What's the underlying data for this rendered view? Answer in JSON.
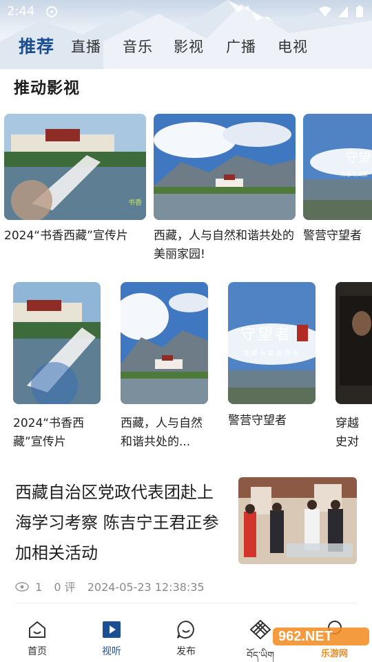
{
  "status_bar": {
    "time": "2:44"
  },
  "tabs": [
    {
      "label": "推荐",
      "active": true
    },
    {
      "label": "直播",
      "active": false
    },
    {
      "label": "音乐",
      "active": false
    },
    {
      "label": "影视",
      "active": false
    },
    {
      "label": "广播",
      "active": false
    },
    {
      "label": "电视",
      "active": false
    }
  ],
  "section": {
    "title": "推动影视"
  },
  "row1": [
    {
      "title": "2024“书香西藏”宣传片"
    },
    {
      "title": "西藏，人与自然和谐共处的美丽家园!"
    },
    {
      "title": "警营守望者"
    }
  ],
  "row2": [
    {
      "title": "2024“书香西藏”宣传片"
    },
    {
      "title": "西藏，人与自然和谐共处的..."
    },
    {
      "title": "警营守望者",
      "overlay_title": "守望者",
      "overlay_sub": "青春与高原同在"
    },
    {
      "title": "穿越史对"
    }
  ],
  "news": {
    "title": "西藏自治区党政代表团赴上海学习考察 陈吉宁王君正参加相关活动",
    "views": "1",
    "comments": "0 评",
    "date": "2024-05-23 12:38:35"
  },
  "bottom_nav": [
    {
      "label": "首页",
      "icon": "home-icon",
      "active": false
    },
    {
      "label": "视听",
      "icon": "play-icon",
      "active": true
    },
    {
      "label": "发布",
      "icon": "chat-icon",
      "active": false
    },
    {
      "label": "བོད་ཡིག",
      "icon": "knot-icon",
      "active": false
    },
    {
      "label": "",
      "icon": "profile-icon",
      "active": false
    }
  ],
  "watermark": {
    "text": "962.NET",
    "sub": "乐游网"
  },
  "colors": {
    "accent": "#1b4f94",
    "text": "#222222",
    "meta": "#8a8a8a"
  }
}
